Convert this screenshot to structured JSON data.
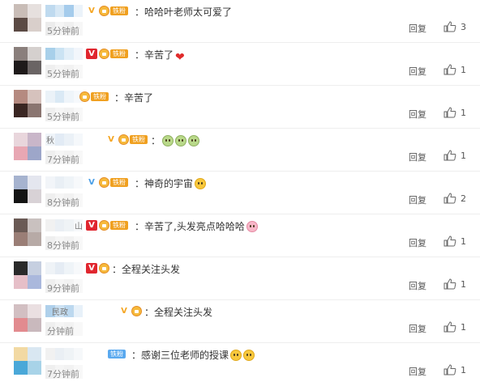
{
  "colors": {
    "vip_orange": "#f5a623",
    "vip_red": "#e0262f",
    "fan_orange": "#f0a020",
    "fan_blue": "#5aa9ef"
  },
  "icons": {
    "like": "thumbs-up-icon",
    "fan_badge": "fan-badge-icon",
    "vip": "vip-badge-icon"
  },
  "comments": [
    {
      "name": "",
      "time": "5分钟前",
      "text": "：哈哈叶老师太可爱了",
      "reply": "回复",
      "likes": "3",
      "fan": "铁粉"
    },
    {
      "name": "",
      "time": "5分钟前",
      "text": "：辛苦了",
      "reply": "回复",
      "likes": "1",
      "fan": "铁粉"
    },
    {
      "name": "",
      "time": "5分钟前",
      "text": "：辛苦了",
      "reply": "回复",
      "likes": "1",
      "fan": "铁粉"
    },
    {
      "name": "秋",
      "time": "7分钟前",
      "text": "：",
      "reply": "回复",
      "likes": "1",
      "fan": "铁粉"
    },
    {
      "name": "",
      "time": "8分钟前",
      "text": "：神奇的宇宙",
      "reply": "回复",
      "likes": "2",
      "fan": "铁粉"
    },
    {
      "name": "山",
      "time": "8分钟前",
      "text": "：辛苦了,头发亮点哈哈哈",
      "reply": "回复",
      "likes": "1",
      "fan": "铁粉"
    },
    {
      "name": "",
      "time": "9分钟前",
      "text": "：全程关注头发",
      "reply": "回复",
      "likes": "1",
      "fan": ""
    },
    {
      "name": "民政",
      "time": "分钟前",
      "text": "：全程关注头发",
      "reply": "回复",
      "likes": "1",
      "fan": ""
    },
    {
      "name": "",
      "time": "7分钟前",
      "text": "：感谢三位老师的授课",
      "reply": "回复",
      "likes": "1",
      "fan": "铁粉"
    }
  ]
}
